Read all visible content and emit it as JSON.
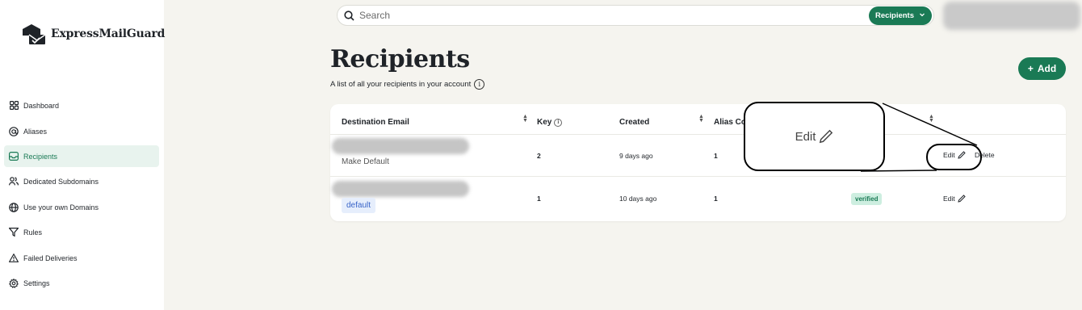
{
  "app": {
    "brand": "ExpressMailGuard"
  },
  "sidebar": {
    "items": [
      {
        "label": "Dashboard",
        "icon": "dashboard-grid-icon",
        "active": false
      },
      {
        "label": "Aliases",
        "icon": "at-sign-icon",
        "active": false
      },
      {
        "label": "Recipients",
        "icon": "inbox-icon",
        "active": true
      },
      {
        "label": "Dedicated Subdomains",
        "icon": "users-icon",
        "active": false
      },
      {
        "label": "Use your own Domains",
        "icon": "globe-icon",
        "active": false
      },
      {
        "label": "Rules",
        "icon": "filter-icon",
        "active": false
      },
      {
        "label": "Failed Deliveries",
        "icon": "warning-triangle-icon",
        "active": false
      },
      {
        "label": "Settings",
        "icon": "gear-icon",
        "active": false
      }
    ]
  },
  "header": {
    "search_placeholder": "Search",
    "scope_label": "Recipients"
  },
  "page": {
    "title": "Recipients",
    "subtitle": "A list of all your recipients in your account",
    "add_label": "Add"
  },
  "table": {
    "columns": [
      "Destination Email",
      "Key",
      "Created",
      "Alias Co"
    ],
    "rows": [
      {
        "email": "",
        "sub": "Make Default",
        "key": "2",
        "created": "9 days ago",
        "aliases": "1",
        "status": "",
        "edit": "Edit",
        "delete": "Delete"
      },
      {
        "email": "",
        "sub": "default",
        "key": "1",
        "created": "10 days ago",
        "aliases": "1",
        "status": "verified",
        "edit": "Edit",
        "delete": ""
      }
    ]
  },
  "callout": {
    "label": "Edit"
  },
  "colors": {
    "accent": "#1a7a55",
    "background": "#f5f4ef",
    "verified_bg": "#cdeee0",
    "default_bg": "#e6eefc"
  }
}
